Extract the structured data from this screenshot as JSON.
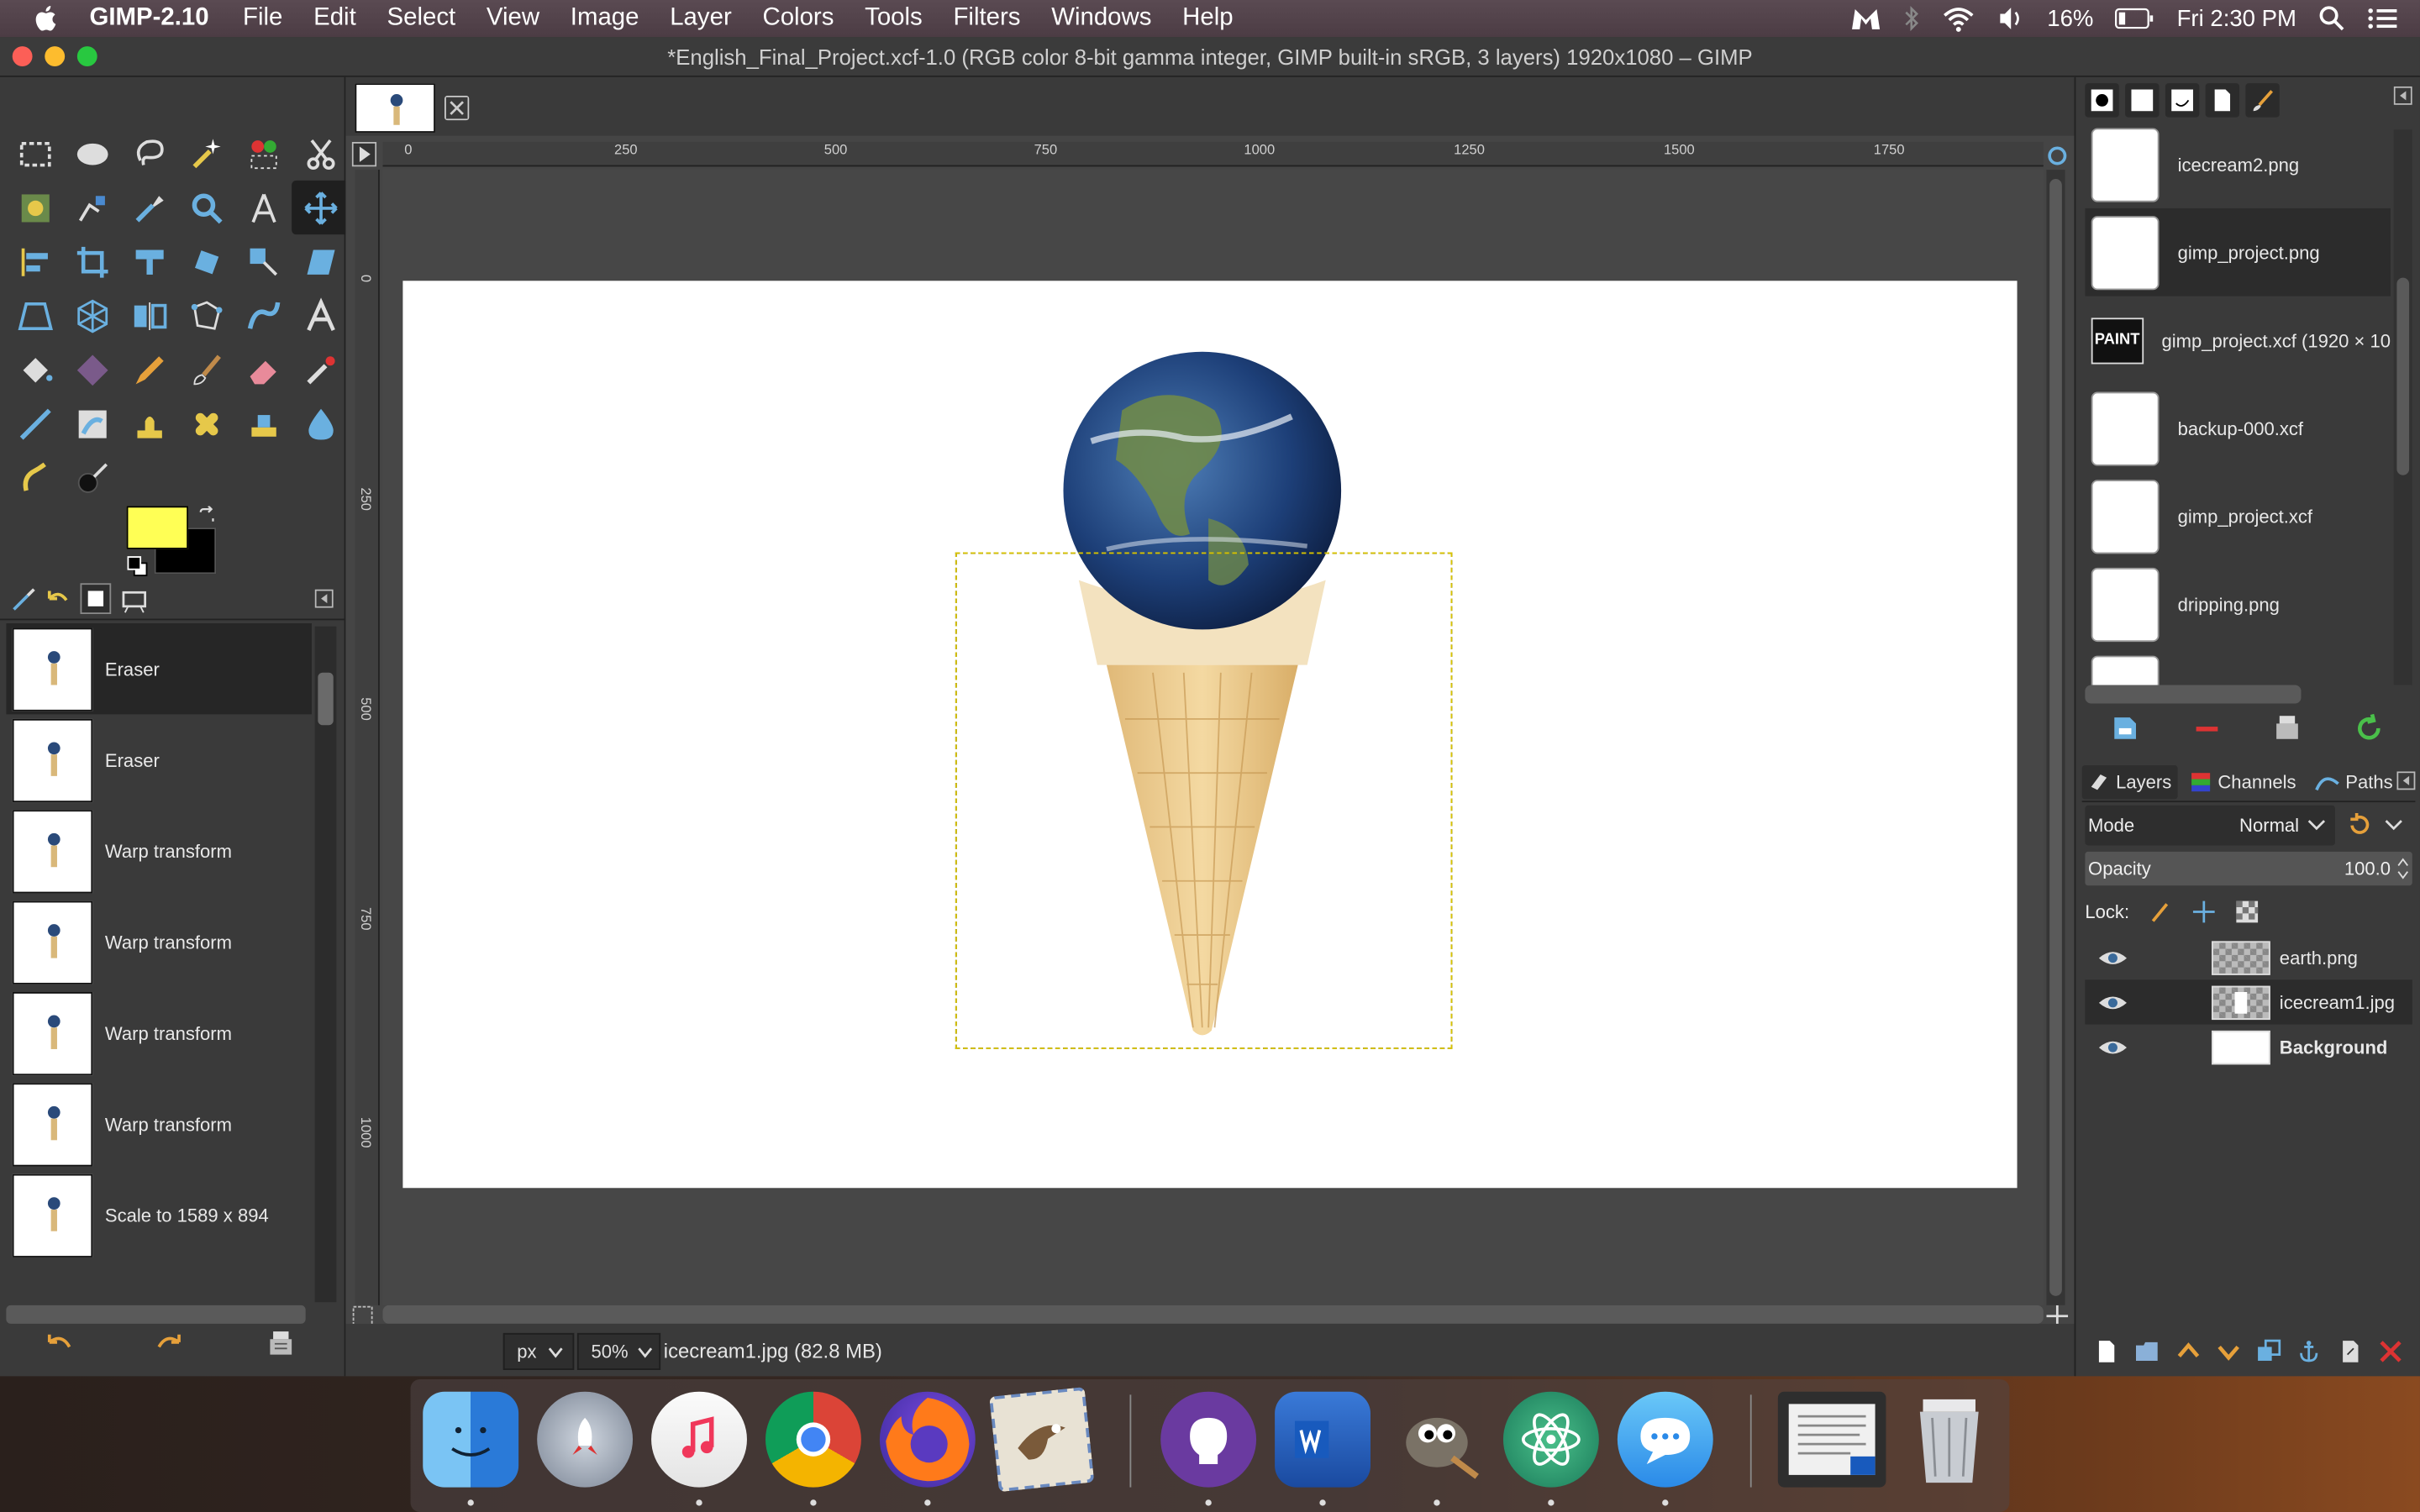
{
  "menubar": {
    "app_name": "GIMP-2.10",
    "items": [
      "File",
      "Edit",
      "Select",
      "View",
      "Image",
      "Layer",
      "Colors",
      "Tools",
      "Filters",
      "Windows",
      "Help"
    ],
    "battery": "16%",
    "clock": "Fri 2:30 PM"
  },
  "window": {
    "title": "*English_Final_Project.xcf-1.0 (RGB color 8-bit gamma integer, GIMP built-in sRGB, 3 layers) 1920x1080 – GIMP"
  },
  "colors": {
    "foreground": "#ffff55",
    "background": "#000000",
    "accent_selection": "#d9c400"
  },
  "undo_history": [
    {
      "label": "Eraser",
      "selected": true
    },
    {
      "label": "Eraser"
    },
    {
      "label": "Warp transform"
    },
    {
      "label": "Warp transform"
    },
    {
      "label": "Warp transform"
    },
    {
      "label": "Warp transform"
    },
    {
      "label": "Scale to 1589 x 894"
    }
  ],
  "rulers": {
    "h_ticks": [
      "0",
      "250",
      "500",
      "750",
      "1000",
      "1250",
      "1500",
      "1750"
    ],
    "v_ticks": [
      "0",
      "250",
      "500",
      "750",
      "1000"
    ]
  },
  "status": {
    "unit": "px",
    "zoom": "50%",
    "info": "icecream1.jpg (82.8 MB)"
  },
  "documents": [
    {
      "label": "icecream2.png",
      "kind": "file"
    },
    {
      "label": "gimp_project.png",
      "kind": "file",
      "selected": true
    },
    {
      "label": "gimp_project.xcf (1920 × 10",
      "kind": "paint",
      "thumb_text": "PAINT"
    },
    {
      "label": "backup-000.xcf",
      "kind": "file"
    },
    {
      "label": "gimp_project.xcf",
      "kind": "file"
    },
    {
      "label": "dripping.png",
      "kind": "file"
    }
  ],
  "layers_panel": {
    "tabs": [
      "Layers",
      "Channels",
      "Paths"
    ],
    "mode_label": "Mode",
    "mode_value": "Normal",
    "opacity_label": "Opacity",
    "opacity_value": "100.0",
    "lock_label": "Lock:",
    "layers": [
      {
        "name": "earth.png",
        "thumb": "checker"
      },
      {
        "name": "icecream1.jpg",
        "thumb": "checker",
        "selected": true
      },
      {
        "name": "Background",
        "thumb": "white",
        "bold": true
      }
    ]
  },
  "dock": {
    "apps": [
      "finder-icon",
      "launchpad-icon",
      "music-icon",
      "chrome-icon",
      "firefox-icon",
      "mail-icon",
      "github-desktop-icon",
      "word-icon",
      "gimp-icon",
      "atom-icon",
      "messages-icon",
      "document-icon",
      "trash-icon"
    ]
  }
}
